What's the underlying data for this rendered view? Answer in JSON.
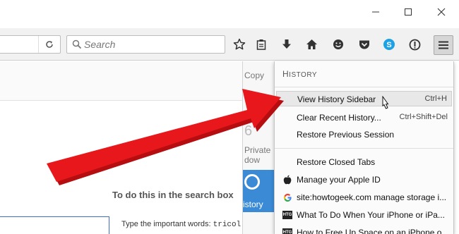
{
  "search": {
    "placeholder": "Search"
  },
  "panel": {
    "copy": "Copy",
    "private_line1": "Private",
    "private_line2": "dow",
    "history_label": "istory",
    "six": "6"
  },
  "page": {
    "heading": "To do this in the search box",
    "small_label": "Type the important words:",
    "small_value": "tricol"
  },
  "history": {
    "title_first": "H",
    "title_rest": "ISTORY",
    "items": [
      {
        "label": "View History Sidebar",
        "shortcut": "Ctrl+H"
      },
      {
        "label": "Clear Recent History...",
        "shortcut": "Ctrl+Shift+Del"
      },
      {
        "label": "Restore Previous Session",
        "shortcut": ""
      }
    ],
    "recent": [
      {
        "label": "Restore Closed Tabs",
        "icon": "none"
      },
      {
        "label": "Manage your Apple ID",
        "icon": "apple-icon"
      },
      {
        "label": "site:howtogeek.com manage storage i...",
        "icon": "google-icon"
      },
      {
        "label": "What To Do When Your iPhone or iPa...",
        "icon": "htg-icon"
      },
      {
        "label": "How to Free Up Space on an iPhone o...",
        "icon": "htg-icon"
      }
    ],
    "htg_text": "HTG"
  },
  "colors": {
    "arrow": "#e8171b",
    "skype": "#1da1e5",
    "accent_blue": "#3a8ad6"
  }
}
